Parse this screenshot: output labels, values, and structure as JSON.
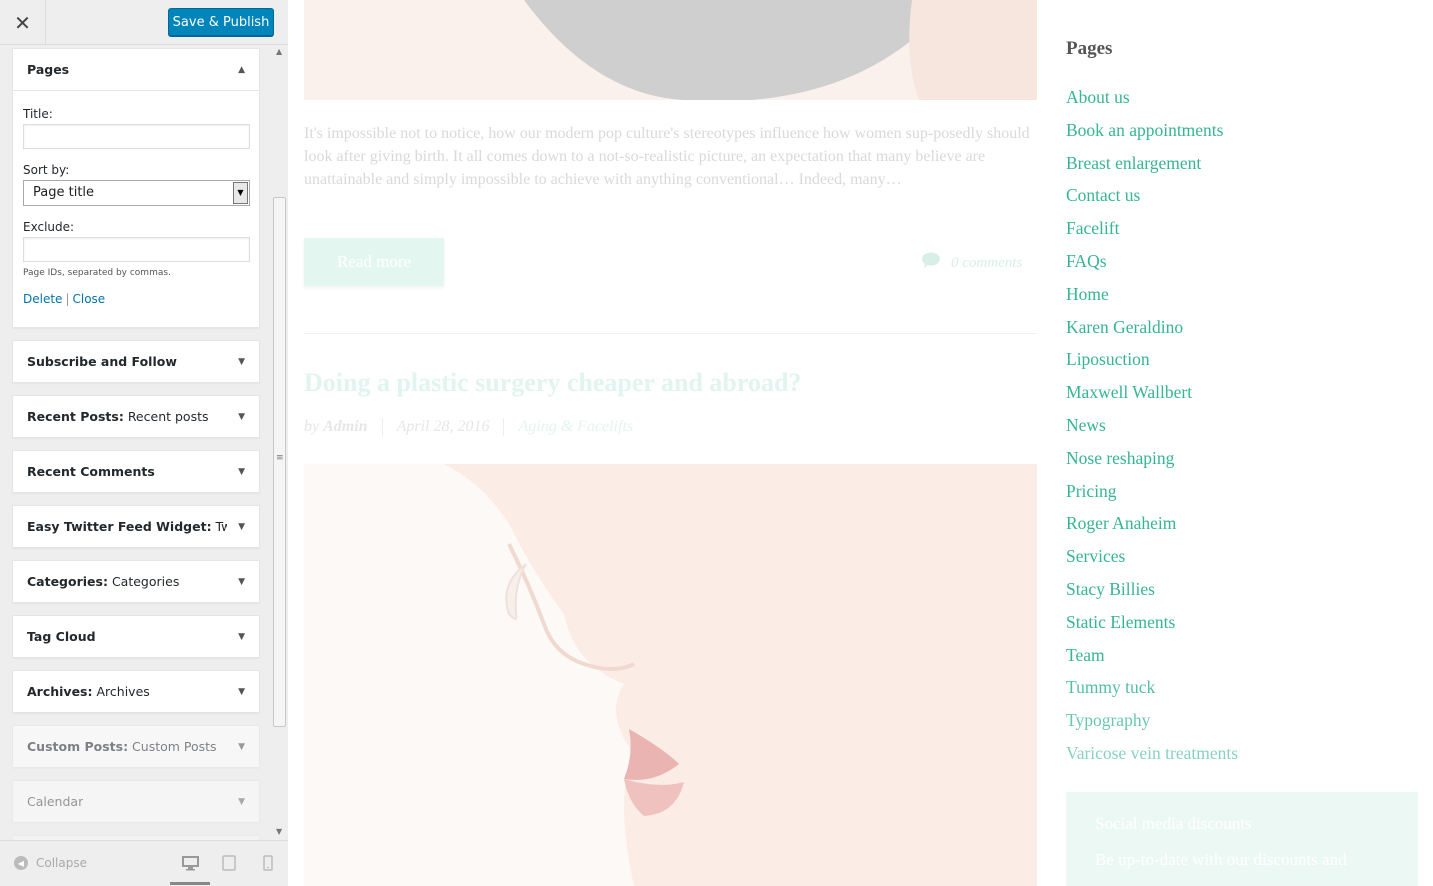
{
  "customizer": {
    "close_icon": "close-icon",
    "publish_label": "Save & Publish",
    "pages_widget": {
      "title": "Pages",
      "title_label": "Title:",
      "title_value": "",
      "sort_label": "Sort by:",
      "sort_value": "Page title",
      "exclude_label": "Exclude:",
      "exclude_value": "",
      "hint": "Page IDs, separated by commas.",
      "delete_label": "Delete",
      "separator": "|",
      "close_label": "Close"
    },
    "widgets": [
      {
        "name": "Subscribe and Follow",
        "subtitle": ""
      },
      {
        "name": "Recent Posts",
        "subtitle": "Recent posts"
      },
      {
        "name": "Recent Comments",
        "subtitle": ""
      },
      {
        "name": "Easy Twitter Feed Widget",
        "subtitle": "Twi..."
      },
      {
        "name": "Categories",
        "subtitle": "Categories"
      },
      {
        "name": "Tag Cloud",
        "subtitle": ""
      },
      {
        "name": "Archives",
        "subtitle": "Archives"
      },
      {
        "name": "Custom Posts",
        "subtitle": "Custom Posts"
      },
      {
        "name": "Calendar",
        "subtitle": ""
      }
    ],
    "collapse_label": "Collapse"
  },
  "preview": {
    "excerpt": "It's impossible not to notice, how our modern pop culture's stereotypes influence how women sup-posedly should look after giving birth. It all comes down to a not-so-realistic picture, an expectation that many believe are unattainable and simply impossible to achieve with anything conventional… Indeed, many…",
    "read_more": "Read more",
    "comments": "0 comments",
    "post_title": "Doing a plastic surgery cheaper and abroad?",
    "meta_by": "by",
    "meta_author": "Admin",
    "meta_date": "April 28, 2016",
    "meta_category": "Aging & Facelifts",
    "pages_heading": "Pages",
    "pages": [
      "About us",
      "Book an appointments",
      "Breast enlargement",
      "Contact us",
      "Facelift",
      "FAQs",
      "Home",
      "Karen Geraldino",
      "Liposuction",
      "Maxwell Wallbert",
      "News",
      "Nose reshaping",
      "Pricing",
      "Roger Anaheim",
      "Services",
      "Stacy Billies",
      "Static Elements",
      "Team",
      "Tummy tuck",
      "Typography",
      "Varicose vein treatments"
    ],
    "social_title": "Social media discounts",
    "social_text": "Be up-to-date with our discounts and"
  },
  "colors": {
    "publish": "#0085ba",
    "link": "#0073aa",
    "accent": "#36b594"
  }
}
